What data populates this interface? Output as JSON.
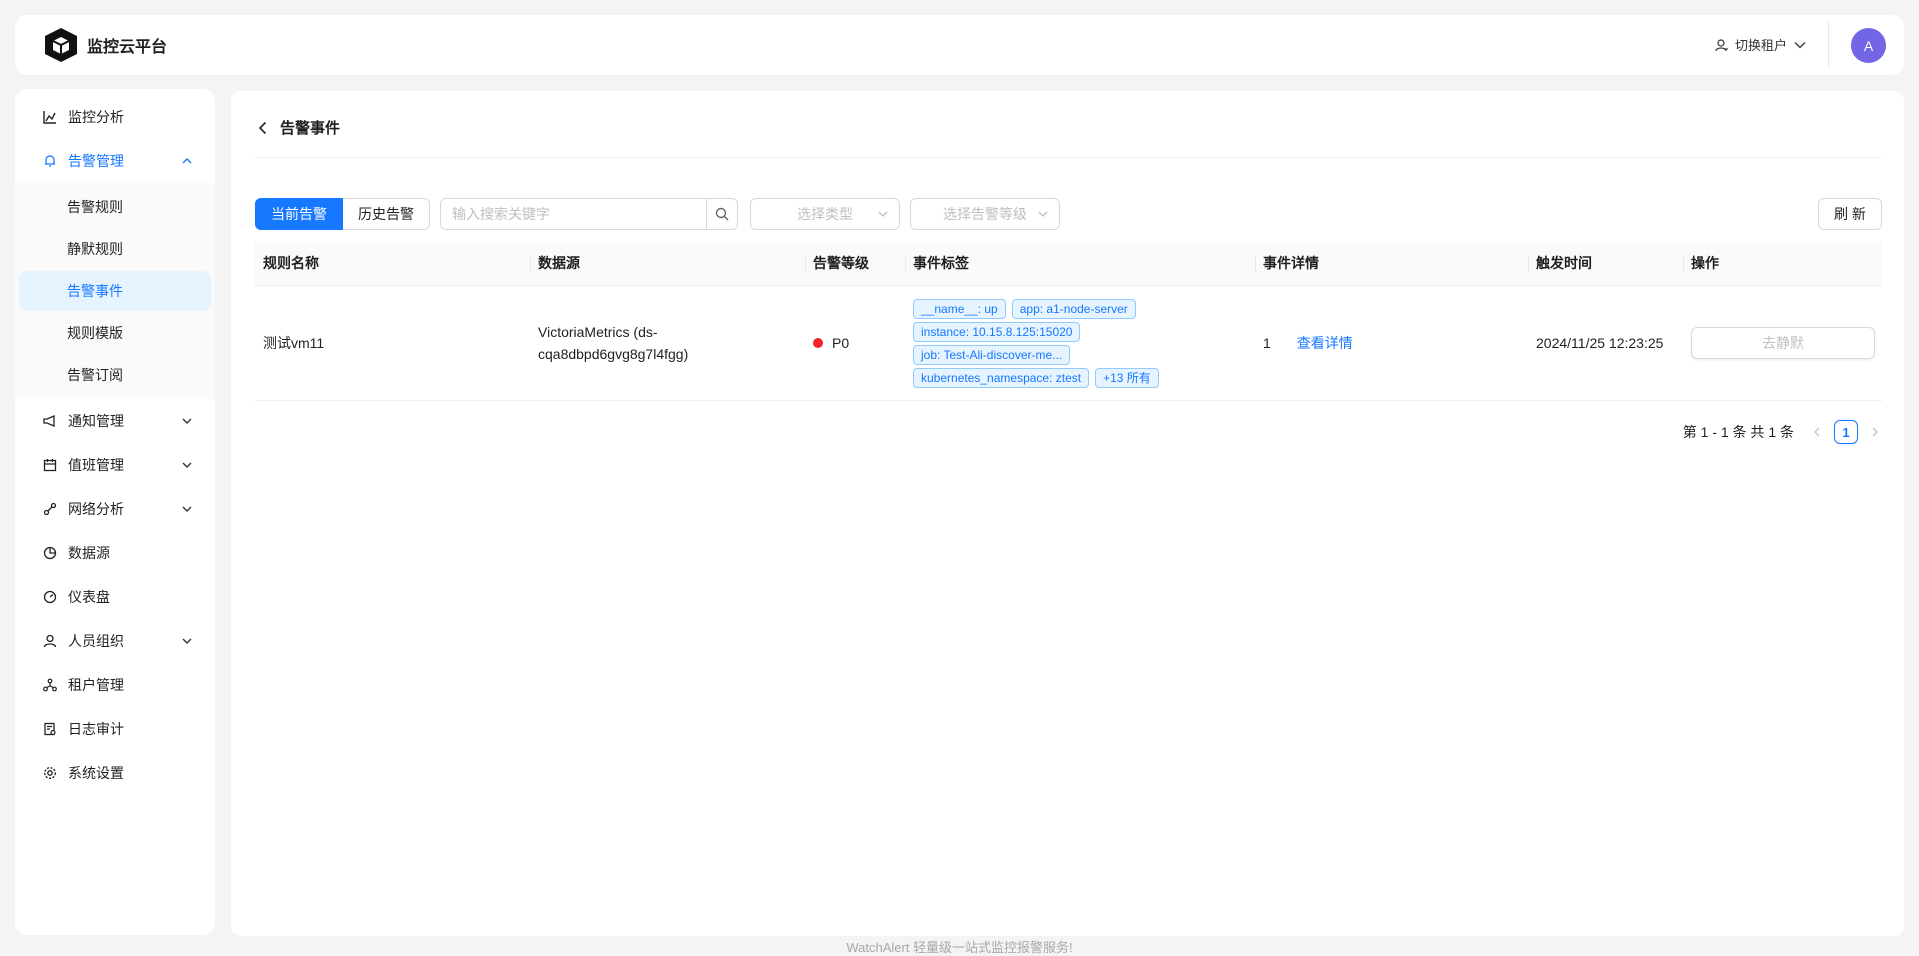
{
  "header": {
    "app_title": "监控云平台",
    "tenant_switch_label": "切换租户",
    "avatar_initial": "A"
  },
  "sidebar": {
    "items": [
      {
        "label": "监控分析",
        "icon": "chart-icon"
      },
      {
        "label": "告警管理",
        "icon": "bell-icon",
        "expanded": true,
        "children": [
          {
            "label": "告警规则"
          },
          {
            "label": "静默规则"
          },
          {
            "label": "告警事件",
            "selected": true
          },
          {
            "label": "规则模版"
          },
          {
            "label": "告警订阅"
          }
        ]
      },
      {
        "label": "通知管理",
        "icon": "megaphone-icon"
      },
      {
        "label": "值班管理",
        "icon": "calendar-icon"
      },
      {
        "label": "网络分析",
        "icon": "network-icon"
      },
      {
        "label": "数据源",
        "icon": "pie-icon"
      },
      {
        "label": "仪表盘",
        "icon": "dashboard-icon"
      },
      {
        "label": "人员组织",
        "icon": "user-icon"
      },
      {
        "label": "租户管理",
        "icon": "tenant-icon"
      },
      {
        "label": "日志审计",
        "icon": "audit-icon"
      },
      {
        "label": "系统设置",
        "icon": "gear-icon"
      }
    ]
  },
  "page": {
    "title": "告警事件"
  },
  "toolbar": {
    "tab_current": "当前告警",
    "tab_history": "历史告警",
    "search_placeholder": "输入搜索关键字",
    "type_placeholder": "选择类型",
    "level_placeholder": "选择告警等级",
    "refresh_label": "刷 新"
  },
  "table": {
    "columns": [
      "规则名称",
      "数据源",
      "告警等级",
      "事件标签",
      "事件详情",
      "触发时间",
      "操作"
    ],
    "rows": [
      {
        "rule_name": "测试vm11",
        "datasource": "VictoriaMetrics (ds-cqa8dbpd6gvg8g7l4fgg)",
        "severity": "P0",
        "severity_color": "#f5222d",
        "tags": [
          "__name__: up",
          "app: a1-node-server",
          "instance: 10.15.8.125:15020",
          "job: Test-Ali-discover-me...",
          "kubernetes_namespace: ztest",
          "+13 所有"
        ],
        "detail_count": "1",
        "detail_link": "查看详情",
        "trigger_time": "2024/11/25 12:23:25",
        "action_label": "去静默"
      }
    ]
  },
  "pagination": {
    "summary": "第 1 - 1 条 共 1 条",
    "current_page": "1"
  },
  "footer": {
    "text": "WatchAlert 轻量级一站式监控报警服务!"
  },
  "colors": {
    "primary": "#1677ff",
    "avatar_bg": "#7265e6",
    "selected_bg": "#e6f4ff"
  }
}
